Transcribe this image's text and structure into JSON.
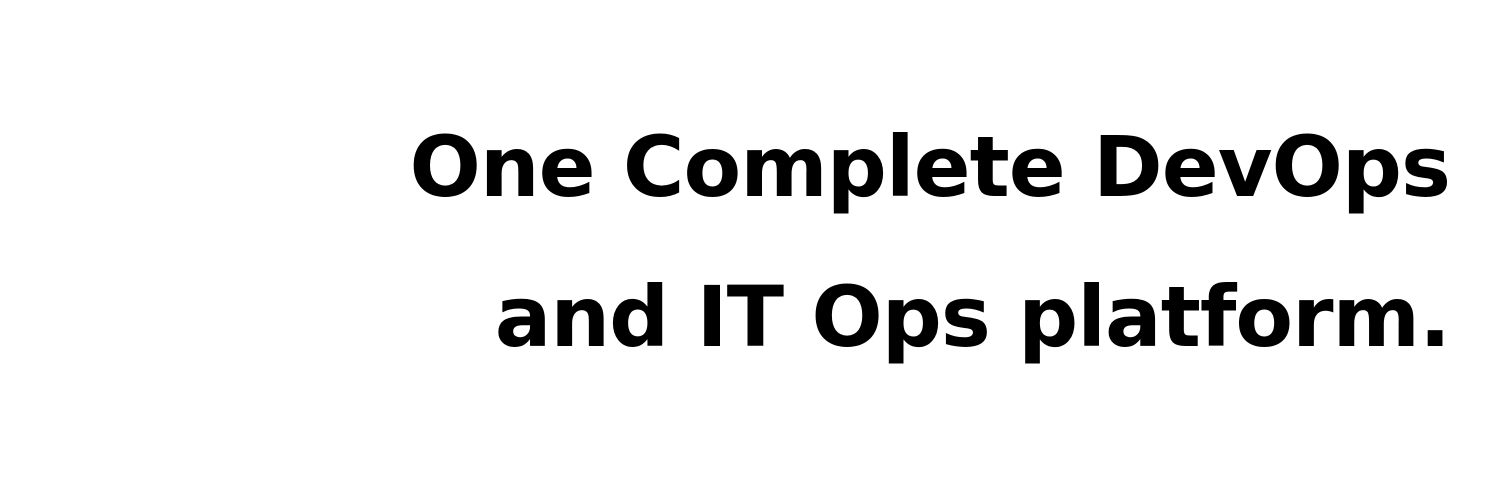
{
  "banner": {
    "headline_lines": [
      "One Complete DevOps",
      "and IT Ops platform."
    ],
    "text_color": "#000000",
    "background_color": "#ffffff"
  }
}
